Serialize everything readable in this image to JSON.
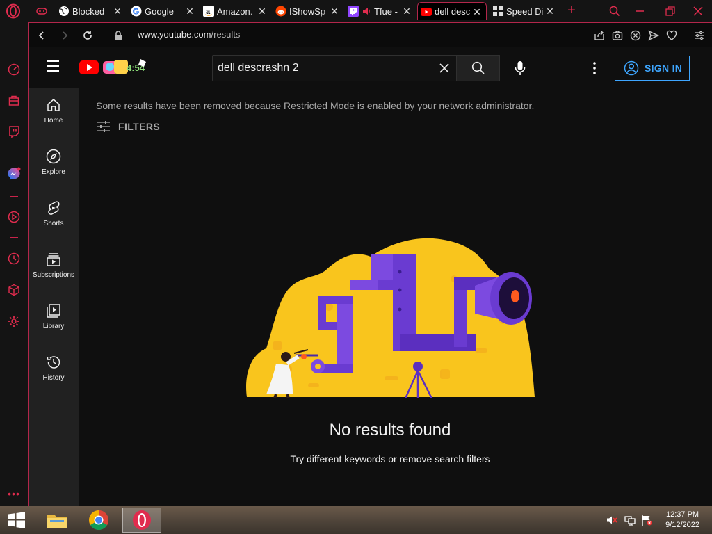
{
  "browser": {
    "tabs": [
      {
        "label": "Blocked",
        "icon": "globe-icon"
      },
      {
        "label": "Google",
        "icon": "google-icon"
      },
      {
        "label": "Amazon.",
        "icon": "amazon-icon"
      },
      {
        "label": "IShowSp",
        "icon": "reddit-icon"
      },
      {
        "label": "Tfue -",
        "icon": "twitch-icon"
      },
      {
        "label": "dell desc",
        "icon": "youtube-icon",
        "active": true
      },
      {
        "label": "Speed Di",
        "icon": "speed-dial-icon"
      }
    ],
    "url_host": "www.youtube.com",
    "url_path": "/results"
  },
  "youtube": {
    "search_query": "dell descrashn 2",
    "sign_in_label": "SIGN IN",
    "guide": [
      {
        "label": "Home",
        "icon": "home-icon"
      },
      {
        "label": "Explore",
        "icon": "compass-icon"
      },
      {
        "label": "Shorts",
        "icon": "shorts-icon"
      },
      {
        "label": "Subscriptions",
        "icon": "subscriptions-icon"
      },
      {
        "label": "Library",
        "icon": "library-icon"
      },
      {
        "label": "History",
        "icon": "history-icon"
      }
    ],
    "restricted_notice": "Some results have been removed because Restricted Mode is enabled by your network administrator.",
    "filters_label": "FILTERS",
    "no_results_title": "No results found",
    "no_results_subtitle": "Try different keywords or remove search filters"
  },
  "taskbar": {
    "time": "12:37 PM",
    "date": "9/12/2022"
  },
  "colors": {
    "accent": "#e02c4e",
    "link_blue": "#3ea6ff",
    "yt_red": "#ff0000",
    "illus_yellow": "#f9c51d",
    "illus_purple": "#6a3bd1"
  }
}
